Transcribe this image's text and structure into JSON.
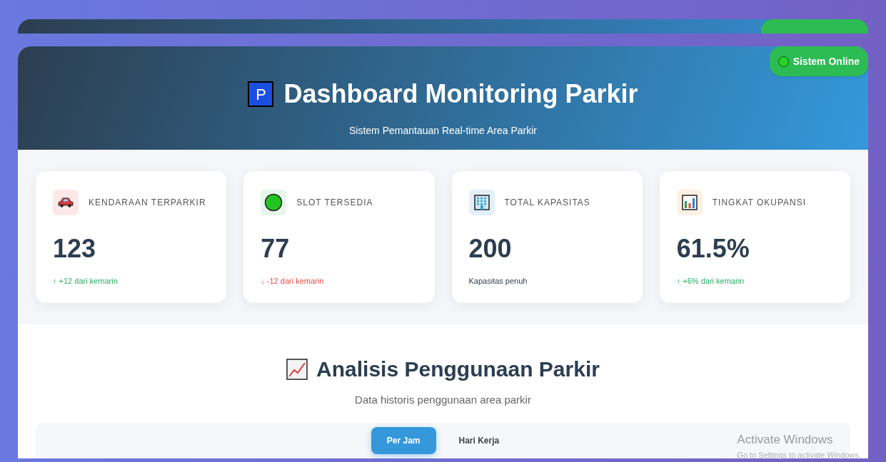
{
  "header": {
    "logo": "P",
    "title": "Dashboard Monitoring Parkir",
    "subtitle": "Sistem Pemantauan Real-time Area Parkir",
    "status": {
      "label": "Sistem Online",
      "online": true
    }
  },
  "stats": [
    {
      "label": "KENDARAAN TERPARKIR",
      "value": "123",
      "note": "↑ +12 dari kemarin",
      "color": "#27ae60"
    },
    {
      "label": "SLOT TERSEDIA",
      "value": "77",
      "note": "↓ -12 dari kemarin",
      "color": "#e74c3c"
    },
    {
      "label": "TOTAL KAPASITAS",
      "value": "200",
      "note": "Kapasitas penuh",
      "color": "#2c3e50"
    },
    {
      "label": "TINGKAT OKUPANSI",
      "value": "61.5%",
      "note": "↑ +6% dari kemarin",
      "color": "#27ae60"
    }
  ],
  "analysis": {
    "title": "Analisis Penggunaan Parkir",
    "subtitle": "Data historis penggunaan area parkir",
    "tabs": [
      {
        "label": "Per Jam",
        "selected": true
      },
      {
        "label": "Hari Kerja",
        "selected": false
      }
    ]
  },
  "os_notice": {
    "title": "Activate Windows",
    "text": "Go to Settings to activate Windows."
  }
}
